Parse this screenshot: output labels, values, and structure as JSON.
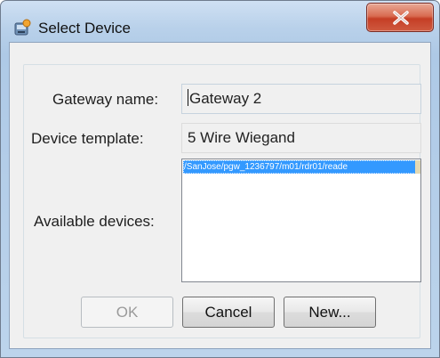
{
  "window": {
    "title": "Select Device",
    "close_label": "X"
  },
  "form": {
    "gateway_name_label": "Gateway name:",
    "gateway_name_value": "Gateway  2",
    "device_template_label": "Device template:",
    "device_template_value": "5 Wire Wiegand",
    "available_devices_label": "Available devices:",
    "available_devices": [
      "/SanJose/pgw_1236797/m01/rdr01/reade"
    ]
  },
  "buttons": {
    "ok_label": "OK",
    "cancel_label": "Cancel",
    "new_label": "New..."
  },
  "colors": {
    "selection": "#3399ff",
    "close_button": "#c53e25"
  }
}
